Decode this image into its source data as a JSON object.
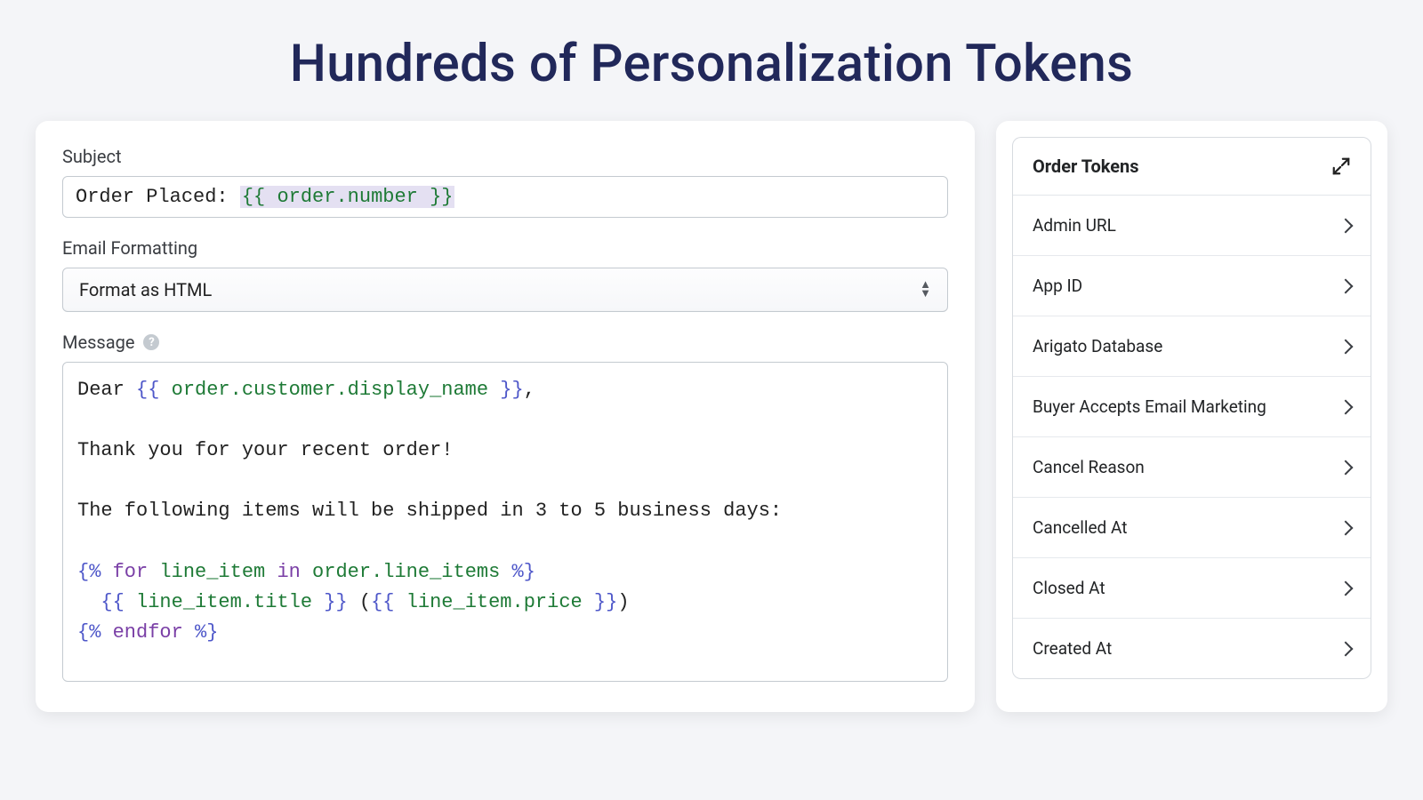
{
  "heading": "Hundreds of Personalization Tokens",
  "form": {
    "subject_label": "Subject",
    "subject_prefix": "Order Placed: ",
    "subject_token": "{{ order.number }}",
    "email_fmt_label": "Email Formatting",
    "email_fmt_selected": "Format as HTML",
    "message_label": "Message",
    "message_lines": [
      [
        {
          "t": "txt",
          "v": "Dear "
        },
        {
          "t": "delim",
          "v": "{{ "
        },
        {
          "t": "var",
          "v": "order.customer.display_name"
        },
        {
          "t": "delim",
          "v": " }}"
        },
        {
          "t": "txt",
          "v": ","
        }
      ],
      [],
      [
        {
          "t": "txt",
          "v": "Thank you for your recent order!"
        }
      ],
      [],
      [
        {
          "t": "txt",
          "v": "The following items will be shipped in 3 to 5 business days:"
        }
      ],
      [],
      [
        {
          "t": "delim",
          "v": "{% "
        },
        {
          "t": "kw",
          "v": "for"
        },
        {
          "t": "var",
          "v": " line_item "
        },
        {
          "t": "kw",
          "v": "in"
        },
        {
          "t": "var",
          "v": " order.line_items"
        },
        {
          "t": "delim",
          "v": " %}"
        }
      ],
      [
        {
          "t": "txt",
          "v": "  "
        },
        {
          "t": "delim",
          "v": "{{ "
        },
        {
          "t": "var",
          "v": "line_item.title"
        },
        {
          "t": "delim",
          "v": " }}"
        },
        {
          "t": "txt",
          "v": " ("
        },
        {
          "t": "delim",
          "v": "{{ "
        },
        {
          "t": "var",
          "v": "line_item.price"
        },
        {
          "t": "delim",
          "v": " }}"
        },
        {
          "t": "txt",
          "v": ")"
        }
      ],
      [
        {
          "t": "delim",
          "v": "{% "
        },
        {
          "t": "kw",
          "v": "endfor"
        },
        {
          "t": "delim",
          "v": " %}"
        }
      ]
    ]
  },
  "sidebar": {
    "title": "Order Tokens",
    "items": [
      "Admin URL",
      "App ID",
      "Arigato Database",
      "Buyer Accepts Email Marketing",
      "Cancel Reason",
      "Cancelled At",
      "Closed At",
      "Created At"
    ]
  }
}
